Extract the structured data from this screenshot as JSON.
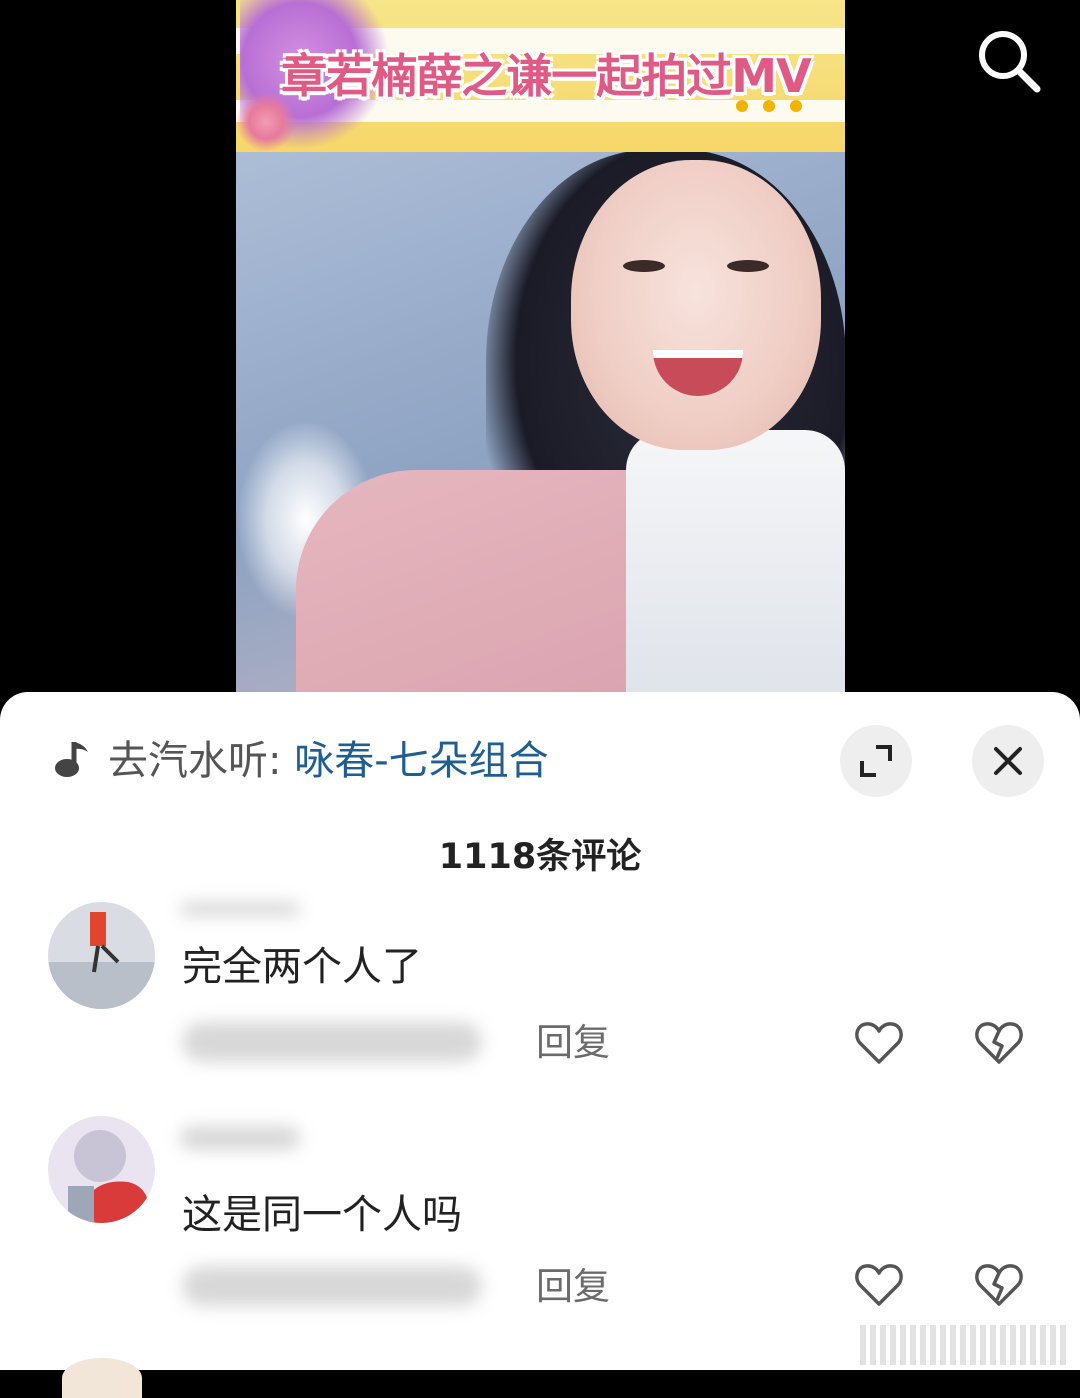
{
  "video": {
    "banner_title": "章若楠薛之谦一起拍过MV"
  },
  "music_bar": {
    "prefix": "去汽水听: ",
    "song": "咏春-七朵组合"
  },
  "comments_header": {
    "count_label": "1118条评论"
  },
  "comments": [
    {
      "text": "完全两个人了",
      "reply_label": "回复"
    },
    {
      "text": "这是同一个人吗",
      "reply_label": "回复"
    }
  ],
  "icons": {
    "search": "search-icon",
    "music": "music-note-icon",
    "expand": "expand-icon",
    "close": "close-icon",
    "like": "heart-icon",
    "dislike": "broken-heart-icon"
  },
  "colors": {
    "song_link": "#1f5e8e",
    "banner_text": "#e05a86"
  }
}
